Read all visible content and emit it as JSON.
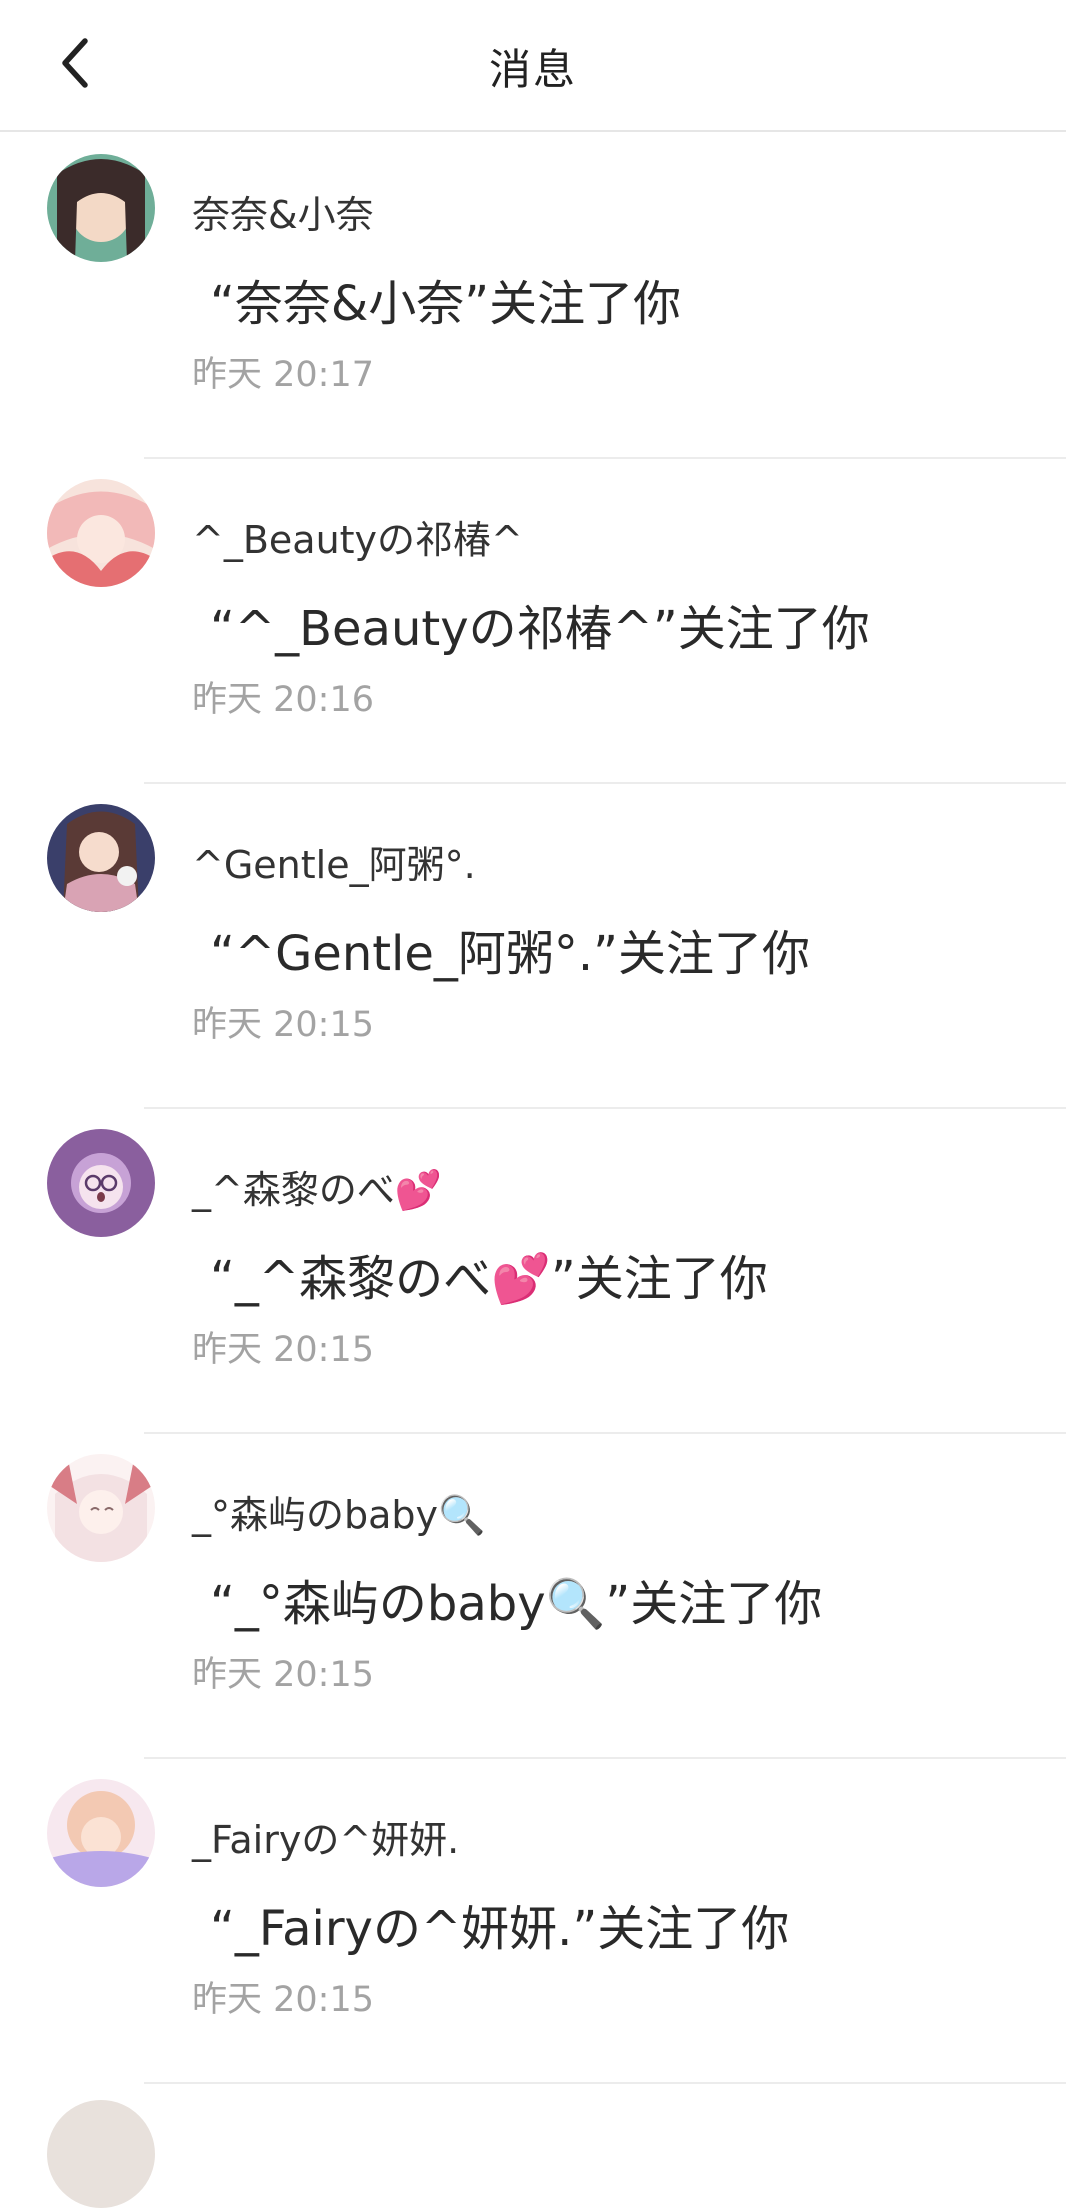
{
  "header": {
    "title": "消息",
    "back_icon": "chevron-left-icon"
  },
  "messages": [
    {
      "name": "奈奈&小奈",
      "text": "“奈奈&小奈”关注了你",
      "time": "昨天 20:17",
      "avatar_colors": [
        "#3b2b2a",
        "#6fae98",
        "#f3d9c6"
      ]
    },
    {
      "name": "^_Beautyの祁椿^",
      "text": "“^_Beautyの祁椿^”关注了你",
      "time": "昨天 20:16",
      "avatar_colors": [
        "#f2b9b8",
        "#e56f72",
        "#f7e3dc"
      ]
    },
    {
      "name": "^Gentle_阿粥°.",
      "text": "“^Gentle_阿粥°.”关注了你",
      "time": "昨天 20:15",
      "avatar_colors": [
        "#5a3a36",
        "#d9a3b4",
        "#3a3f6a"
      ]
    },
    {
      "name": "_^森黎のべ💕",
      "text": "“_^森黎のべ💕”关注了你",
      "time": "昨天 20:15",
      "avatar_colors": [
        "#8a5f9e",
        "#c7a2d6",
        "#f5e3ee"
      ]
    },
    {
      "name": "_°森屿のbaby🔍",
      "text": "“_°森屿のbaby🔍”关注了你",
      "time": "昨天 20:15",
      "avatar_colors": [
        "#f3e1e3",
        "#d87d86",
        "#fbf2f2"
      ]
    },
    {
      "name": "_Fairyの^妍妍.",
      "text": "“_Fairyの^妍妍.”关注了你",
      "time": "昨天 20:15",
      "avatar_colors": [
        "#f3c9b3",
        "#b9a7e8",
        "#f7e8ef"
      ]
    }
  ]
}
